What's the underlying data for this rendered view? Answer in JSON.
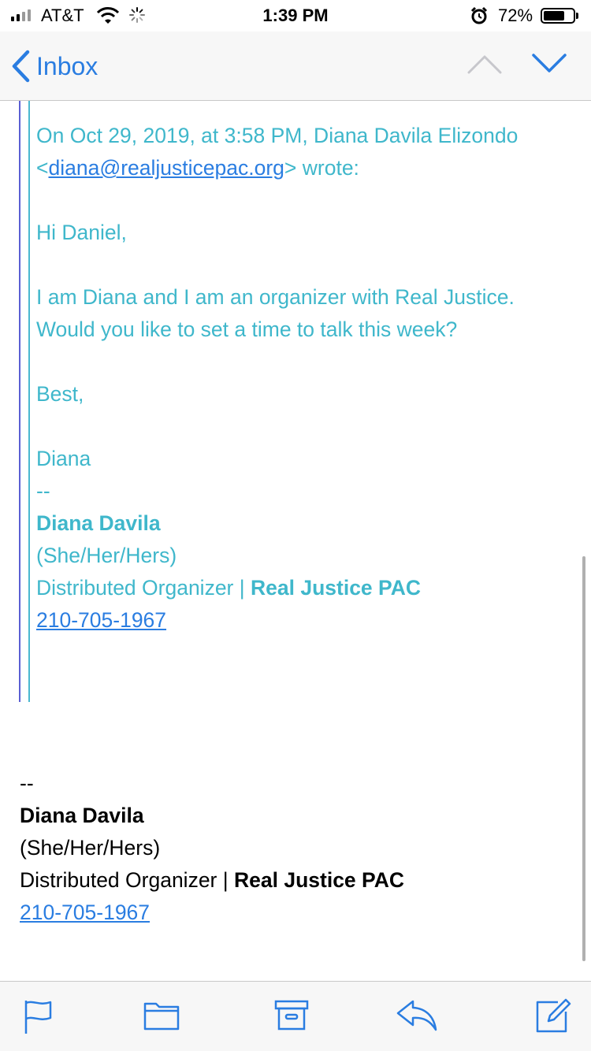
{
  "status_bar": {
    "carrier": "AT&T",
    "time": "1:39 PM",
    "battery_percent": "72%",
    "battery_level": 0.72,
    "icons": [
      "signal-icon",
      "wifi-icon",
      "activity-spinner-icon",
      "alarm-icon",
      "battery-icon"
    ]
  },
  "nav": {
    "back_label": "Inbox",
    "icons": [
      "chevron-left-icon",
      "chevron-up-icon",
      "chevron-down-icon"
    ]
  },
  "quoted": {
    "header_prefix": "On Oct 29, 2019, at 3:58 PM, Diana Davila Elizondo <",
    "email": "diana@realjusticepac.org",
    "header_suffix": "> wrote:",
    "greeting": "Hi Daniel,",
    "body": "I am Diana and I am an organizer with Real Justice. Would you like to set a time to talk this week?",
    "closing": "Best,",
    "name_short": "Diana",
    "dashes": "--",
    "sig_name": "Diana Davila",
    "pronouns": "(She/Her/Hers)",
    "role": "Distributed Organizer | ",
    "org": "Real Justice PAC",
    "phone": "210-705-1967"
  },
  "signature": {
    "dashes": "--",
    "name": "Diana Davila",
    "pronouns": "(She/Her/Hers)",
    "role": "Distributed Organizer | ",
    "org": "Real Justice PAC",
    "phone": "210-705-1967"
  },
  "toolbar": {
    "icons": [
      "flag-icon",
      "folder-icon",
      "archive-icon",
      "reply-icon",
      "compose-icon"
    ]
  },
  "colors": {
    "accent": "#2a7de1",
    "quote_text": "#3fb7cb",
    "quote_bar_outer": "#5b5fd3",
    "quote_bar_inner": "#4bb8cf"
  }
}
